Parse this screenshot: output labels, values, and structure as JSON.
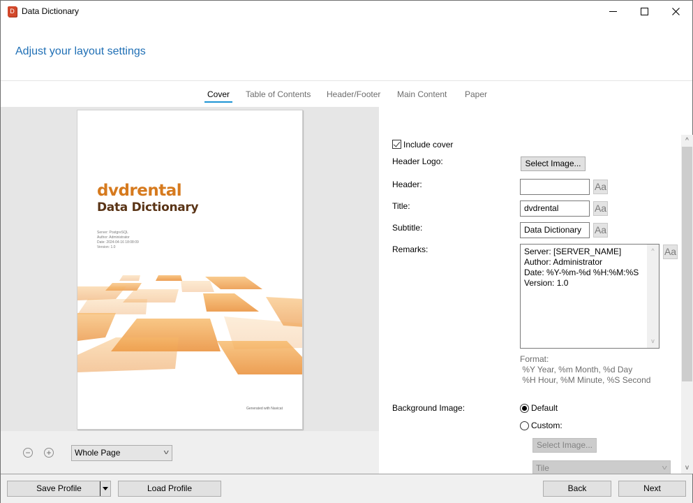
{
  "window": {
    "title": "Data Dictionary",
    "app_icon_letter": "D",
    "controls": {
      "minimize": "minimize",
      "maximize": "maximize",
      "close": "✕"
    }
  },
  "header": {
    "heading": "Adjust your layout settings"
  },
  "tabs": [
    {
      "label": "Cover",
      "active": true
    },
    {
      "label": "Table of Contents",
      "active": false
    },
    {
      "label": "Header/Footer",
      "active": false
    },
    {
      "label": "Main Content",
      "active": false
    },
    {
      "label": "Paper",
      "active": false
    }
  ],
  "preview": {
    "cover_title": "dvdrental",
    "cover_subtitle": "Data Dictionary",
    "cover_remarks": [
      "Server: PostgreSQL",
      "Author: Administrator",
      "Date: 2024-04-16 18:08:09",
      "Version: 1.0"
    ],
    "cover_footer": "Generated with Navicat",
    "accent_color": "#d67a1e",
    "subtitle_color": "#5a3416",
    "zoom_out_symbol": "−",
    "zoom_in_symbol": "+",
    "zoom_mode": "Whole Page"
  },
  "settings": {
    "include_cover": {
      "label": "Include cover",
      "checked": true
    },
    "header_logo": {
      "label": "Header Logo:",
      "button": "Select Image..."
    },
    "header": {
      "label": "Header:",
      "value": "",
      "font_button": "Aa"
    },
    "title": {
      "label": "Title:",
      "value": "dvdrental",
      "font_button": "Aa"
    },
    "subtitle": {
      "label": "Subtitle:",
      "value": "Data Dictionary",
      "font_button": "Aa"
    },
    "remarks": {
      "label": "Remarks:",
      "lines": [
        "Server: [SERVER_NAME]",
        "Author: Administrator",
        "Date: %Y-%m-%d %H:%M:%S",
        "Version: 1.0"
      ],
      "font_button": "Aa"
    },
    "format_hint": {
      "title": "Format:",
      "line1": " %Y Year, %m Month, %d Day",
      "line2": " %H Hour, %M Minute, %S Second"
    },
    "background_image": {
      "label": "Background Image:",
      "options": [
        {
          "label": "Default",
          "checked": true
        },
        {
          "label": "Custom:",
          "checked": false
        }
      ],
      "select_button": "Select Image...",
      "placement": "Tile"
    }
  },
  "footer": {
    "save_profile": "Save Profile",
    "load_profile": "Load Profile",
    "back": "Back",
    "next": "Next"
  },
  "colors": {
    "heading": "#1f6fb5",
    "tab_underline": "#1d94d4"
  }
}
